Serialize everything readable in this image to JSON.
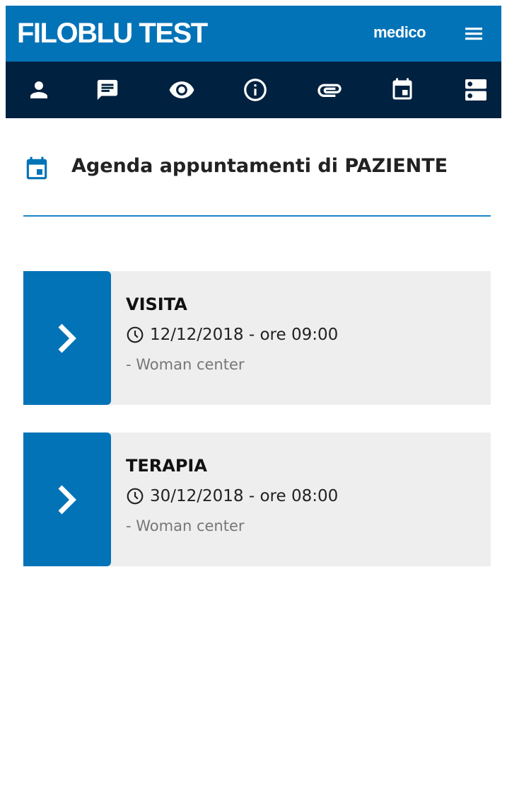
{
  "header": {
    "brand": "FILOBLU TEST",
    "user_role": "medico",
    "menu_icon": "hamburger-menu-icon"
  },
  "toolbar": {
    "icons": [
      "person-icon",
      "message-icon",
      "eye-icon",
      "info-icon",
      "attachment-icon",
      "calendar-icon",
      "server-icon"
    ]
  },
  "agenda": {
    "title": "Agenda appuntamenti di PAZIENTE",
    "icon": "calendar-icon",
    "appointments": [
      {
        "type": "VISITA",
        "datetime": "12/12/2018 - ore 09:00",
        "location": "- Woman center"
      },
      {
        "type": "TERAPIA",
        "datetime": "30/12/2018 - ore 08:00",
        "location": "- Woman center"
      }
    ]
  },
  "colors": {
    "primary": "#0373b8",
    "toolbar_bg": "#00213f",
    "card_bg": "#eeeeee",
    "divider": "#1c87c9"
  }
}
